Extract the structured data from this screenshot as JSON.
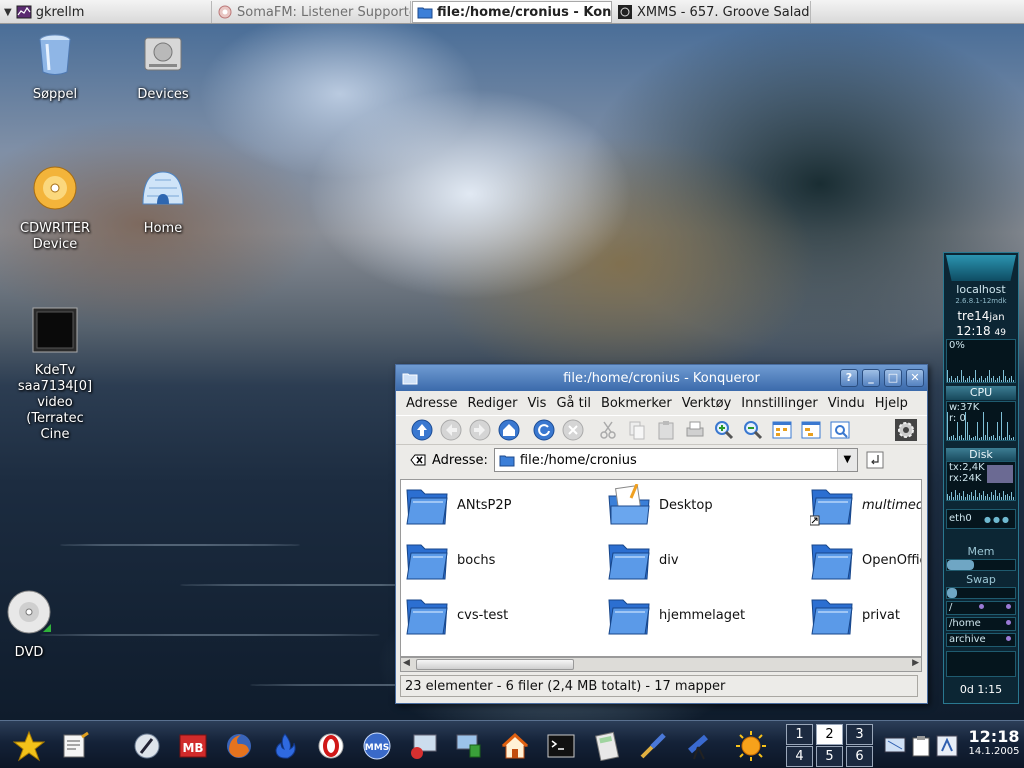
{
  "taskbar": {
    "tasks": [
      {
        "label": "gkrellm",
        "icon": "gkrellm-icon",
        "state": "normal"
      },
      {
        "label": "SomaFM: Listener Supporte",
        "icon": "browser-icon",
        "state": "inactive"
      },
      {
        "label": "file:/home/cronius - Kon",
        "icon": "konqueror-folder-icon",
        "state": "active"
      },
      {
        "label": "XMMS - 657.  Groove Salad",
        "icon": "xmms-icon",
        "state": "normal"
      }
    ]
  },
  "desktop_icons": [
    {
      "label": "Søppel",
      "icon": "trash-icon"
    },
    {
      "label": "Devices",
      "icon": "devices-icon"
    },
    {
      "label": "CDWRITER Device",
      "icon": "cd-writer-icon"
    },
    {
      "label": "Home",
      "icon": "home-igloo-icon"
    },
    {
      "label": "KdeTv saa7134[0] video (Terratec Cine",
      "icon": "tv-icon"
    },
    {
      "label": "DVD",
      "icon": "dvd-icon"
    }
  ],
  "konqueror": {
    "title": "file:/home/cronius - Konqueror",
    "window_buttons": [
      "?",
      "_",
      "□",
      "✕"
    ],
    "menu": [
      "Adresse",
      "Rediger",
      "Vis",
      "Gå til",
      "Bokmerker",
      "Verktøy",
      "Innstillinger",
      "Vindu",
      "Hjelp"
    ],
    "toolbar_icons": [
      "up-arrow-icon",
      "back-icon",
      "forward-icon",
      "home-icon",
      "reload-icon",
      "stop-icon",
      "cut-icon",
      "copy-icon",
      "paste-icon",
      "print-icon",
      "zoom-in-icon",
      "zoom-out-icon",
      "icon-view-icon",
      "tree-view-icon",
      "preview-icon",
      "kde-gear-icon"
    ],
    "location_label": "Adresse:",
    "location_value": "file:/home/cronius",
    "files": [
      {
        "name": "ANtsP2P",
        "icon": "folder-icon"
      },
      {
        "name": "Desktop",
        "icon": "desktop-folder-icon"
      },
      {
        "name": "multimed",
        "icon": "folder-link-icon"
      },
      {
        "name": "bochs",
        "icon": "folder-icon"
      },
      {
        "name": "div",
        "icon": "folder-icon"
      },
      {
        "name": "OpenOffic",
        "icon": "folder-icon"
      },
      {
        "name": "cvs-test",
        "icon": "folder-icon"
      },
      {
        "name": "hjemmelaget",
        "icon": "folder-icon"
      },
      {
        "name": "privat",
        "icon": "folder-icon"
      }
    ],
    "status": "23 elementer -  6 filer (2,4 MB totalt) - 17 mapper"
  },
  "gkrellm": {
    "host": "localhost",
    "kernel": "2.6.8.1-12mdk",
    "day": "tre",
    "date_num": "14",
    "month": "jan",
    "time": "12:18",
    "seconds": "49",
    "cpu_percent": "0%",
    "cpu_label": "CPU",
    "cpu_w": "w:37K",
    "cpu_r": "r: 0",
    "disk_label": "Disk",
    "tx": "tx:2,4K",
    "rx": "rx:24K",
    "net_label": "eth0",
    "mem_label": "Mem",
    "swap_label": "Swap",
    "fs_root": "/",
    "fs_home": "/home",
    "fs_archive": "archive",
    "uptime": "0d  1:15"
  },
  "panel": {
    "launchers": [
      "kde-star-icon",
      "text-editor-icon",
      "pen-tool-icon",
      "mb-app-icon",
      "firefox-icon",
      "flame-icon",
      "opera-icon",
      "mms-icon",
      "display-icon",
      "network-icon",
      "home-icon",
      "terminal-icon",
      "calculator-icon",
      "paintbrush-icon",
      "telescope-icon",
      "sun-icon"
    ],
    "pager": [
      "1",
      "2",
      "3",
      "4",
      "5",
      "6"
    ],
    "active_desktop": "2",
    "tray_icons": [
      "screen-icon",
      "clipboard-icon",
      "kde-tray-icon"
    ],
    "clock_time": "12:18",
    "clock_date": "14.1.2005"
  },
  "colors": {
    "title_bar": "#3b6aab",
    "folder": "#2c6fd1",
    "gkrellm_bg": "#0c2634"
  }
}
